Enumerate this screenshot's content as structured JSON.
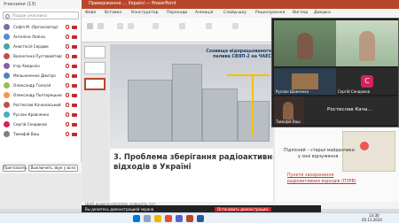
{
  "ppt": {
    "window_title": "Приверження … Україні — PowerPoint",
    "menu": [
      "Файл",
      "Вставка",
      "Конструктор",
      "Переходи",
      "Анімація",
      "Слайд-шоу",
      "Рецензування",
      "Вигляд",
      "Довідка"
    ],
    "slide": {
      "top_title_1": "Сховище відпрацьованого",
      "top_title_2": "палива СВЯП-2 на ЧАЕС",
      "heading_1": "3. Проблема зберігання радіоактивних",
      "heading_2": "відходів в Україні"
    },
    "map": {
      "label_1": "Підлісний – старші майданчики",
      "label_2": "у зоні відчуження",
      "label_3": "Пункти захоронення",
      "label_4": "радіоактивних відходів (ПЗРВ)"
    },
    "notes_placeholder": "Щоб додати нотатки, клацніть тут"
  },
  "teams": {
    "panel_title": "Учасники (13)",
    "search_placeholder": "Пошук учасника",
    "participants": [
      {
        "name": "Софія М. (Організатор)",
        "color": "#7b6ea8"
      },
      {
        "name": "Ангеліна Лапіна",
        "color": "#5b8bd0"
      },
      {
        "name": "Анастасія Сердюк",
        "color": "#4aa3a3"
      },
      {
        "name": "Валентина Пустовойтова 207-1",
        "color": "#c0504d"
      },
      {
        "name": "Ігор Хмарскін",
        "color": "#8064a2"
      },
      {
        "name": "Мельниченко Дмитро",
        "color": "#4f81bd"
      },
      {
        "name": "Олександр Голосій",
        "color": "#9bbb59"
      },
      {
        "name": "Олександр Полтарецький 207-1",
        "color": "#f79646"
      },
      {
        "name": "Ростислав Качанівський",
        "color": "#c0504d"
      },
      {
        "name": "Руслан Кравченко",
        "color": "#4bacc6"
      },
      {
        "name": "Сергій Сендюков",
        "color": "#d6225b"
      },
      {
        "name": "Тимофій Ваш",
        "color": "#7f7f7f"
      }
    ],
    "invite_button": "Пригласить",
    "mute_all_button": "Выключить звук у всех"
  },
  "video": {
    "tiles": [
      {
        "name": "Руслан Шавченко"
      },
      {
        "name": "Сергій Сендюков",
        "initial": "С"
      },
      {
        "name": "Тимофій Ваш"
      },
      {
        "name": "Ростислав Кача…"
      }
    ]
  },
  "share_bar": {
    "text": "Вы делитесь демонстрацией экрана",
    "stop": "Остановить демонстрацию"
  },
  "taskbar": {
    "time": "13:30",
    "date": "05.11.2024"
  }
}
